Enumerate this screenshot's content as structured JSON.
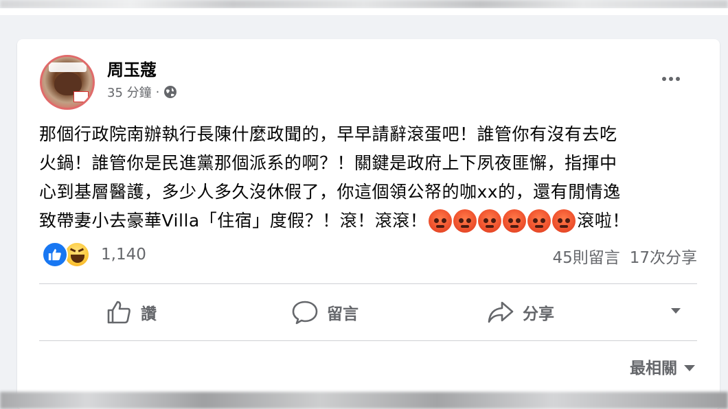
{
  "post": {
    "author": "周玉蔻",
    "time": "35 分鐘",
    "separator": "·",
    "privacy_icon": "globe-icon",
    "lines": [
      "那個行政院南辦執行長陳什麼政聞的，早早請辭滾蛋吧！誰管你有沒有去吃",
      "火鍋！誰管你是民進黨那個派系的啊？！關鍵是政府上下夙夜匪懈，指揮中",
      "心到基層醫護，多少人多久沒休假了，你這個領公帑的咖xx的，還有閒情逸",
      "致帶妻小去豪華Villa「住宿」度假？！滾！滾滾！",
      "滾啦！"
    ],
    "angry_emoji_count": 6
  },
  "reactions": {
    "types": [
      "like-icon",
      "haha-icon"
    ],
    "count": "1,140",
    "comments": "45則留言",
    "shares": "17次分享"
  },
  "actions": {
    "like": "讚",
    "comment": "留言",
    "share": "分享"
  },
  "sort": {
    "label": "最相關"
  },
  "colors": {
    "like_blue": "#1877f2",
    "secondary_text": "#65676b",
    "background": "#f0f2f5"
  }
}
